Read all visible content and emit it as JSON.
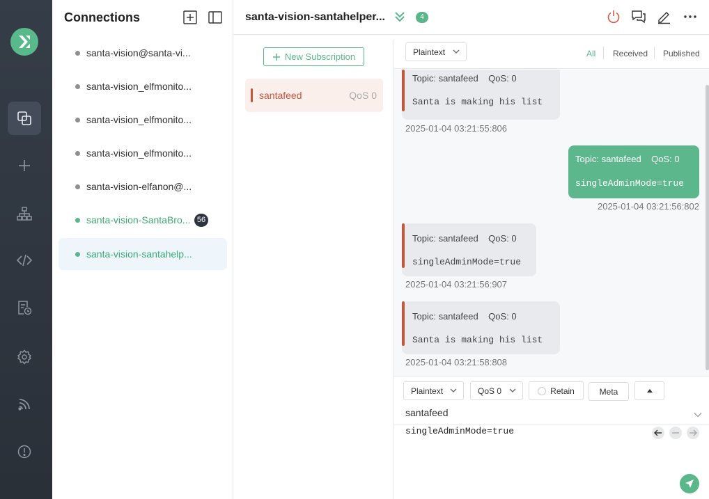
{
  "sidebar": {
    "icons": [
      "logo-icon",
      "connections-icon",
      "plus-icon",
      "topology-icon",
      "code-icon",
      "log-icon",
      "gear-icon",
      "feed-icon",
      "info-icon"
    ]
  },
  "connections": {
    "title": "Connections",
    "items": [
      {
        "label": "santa-vision@santa-vi...",
        "status": "offline"
      },
      {
        "label": "santa-vision_elfmonito...",
        "status": "offline"
      },
      {
        "label": "santa-vision_elfmonito...",
        "status": "offline"
      },
      {
        "label": "santa-vision_elfmonito...",
        "status": "offline"
      },
      {
        "label": "santa-vision-elfanon@...",
        "status": "offline"
      },
      {
        "label": "santa-vision-SantaBro...",
        "status": "online",
        "badge": "56"
      },
      {
        "label": "santa-vision-santahelp...",
        "status": "online",
        "active": true
      }
    ]
  },
  "header": {
    "name": "santa-vision-santahelper...",
    "count": "4"
  },
  "subscriptions": {
    "new_label": "New Subscription",
    "items": [
      {
        "topic": "santafeed",
        "qos": "QoS 0",
        "color": "#c8553a"
      }
    ]
  },
  "message_toolbar": {
    "format": "Plaintext",
    "filters": [
      "All",
      "Received",
      "Published"
    ],
    "active_filter": "All"
  },
  "messages": [
    {
      "direction": "in",
      "topic": "Topic: santafeed",
      "qos": "QoS: 0",
      "payload": "Santa is making his list",
      "time": "2025-01-04 03:21:55:806"
    },
    {
      "direction": "out",
      "topic": "Topic: santafeed",
      "qos": "QoS: 0",
      "payload": "singleAdminMode=true",
      "time": "2025-01-04 03:21:56:802"
    },
    {
      "direction": "in",
      "topic": "Topic: santafeed",
      "qos": "QoS: 0",
      "payload": "singleAdminMode=true",
      "time": "2025-01-04 03:21:56:907"
    },
    {
      "direction": "in",
      "topic": "Topic: santafeed",
      "qos": "QoS: 0",
      "payload": "Santa is making his list",
      "time": "2025-01-04 03:21:58:808"
    }
  ],
  "compose": {
    "format": "Plaintext",
    "qos": "QoS 0",
    "retain_label": "Retain",
    "meta_label": "Meta",
    "topic": "santafeed",
    "payload": "singleAdminMode=true"
  },
  "colors": {
    "accent": "#5ab78a",
    "topic_color": "#c8553a",
    "rail_bg": "#353d48"
  }
}
